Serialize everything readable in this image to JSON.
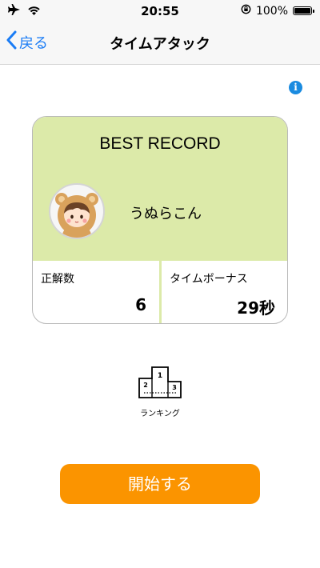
{
  "status_bar": {
    "time": "20:55",
    "battery_text": "100%",
    "icons": [
      "airplane-icon",
      "wifi-icon",
      "rotation-lock-icon",
      "battery-icon"
    ]
  },
  "nav": {
    "back_label": "戻る",
    "title": "タイムアタック"
  },
  "info_icon": {
    "symbol": "i",
    "color": "#1a8be0"
  },
  "best_record": {
    "heading": "BEST RECORD",
    "player_name": "うぬらこん",
    "stats": [
      {
        "label": "正解数",
        "value": "6"
      },
      {
        "label": "タイムボーナス",
        "value": "29秒"
      }
    ],
    "colors": {
      "top_background": "#dceaa9"
    }
  },
  "ranking": {
    "label": "ランキング"
  },
  "start": {
    "label": "開始する",
    "color": "#fb9400"
  },
  "colors": {
    "accent_blue": "#1a7cf5"
  }
}
